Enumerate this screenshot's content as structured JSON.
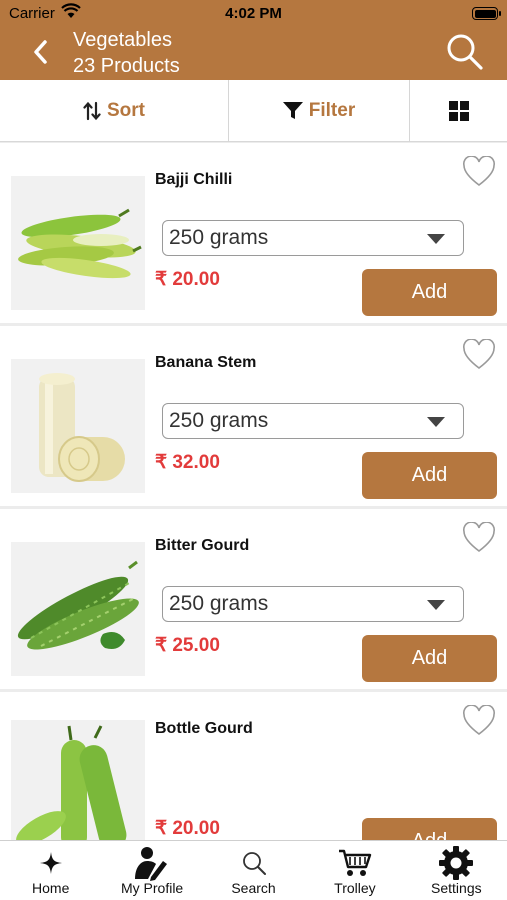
{
  "status_bar": {
    "carrier": "Carrier",
    "time": "4:02 PM"
  },
  "header": {
    "category": "Vegetables",
    "product_count": "23 Products"
  },
  "toolbar": {
    "sort_label": "Sort",
    "filter_label": "Filter"
  },
  "colors": {
    "brand": "#b5773f",
    "price": "#e23b3b"
  },
  "products": [
    {
      "name": "Bajji Chilli",
      "quantity": "250 grams",
      "price": "₹ 20.00",
      "add_label": "Add"
    },
    {
      "name": "Banana Stem",
      "quantity": "250 grams",
      "price": "₹ 32.00",
      "add_label": "Add"
    },
    {
      "name": "Bitter Gourd",
      "quantity": "250 grams",
      "price": "₹ 25.00",
      "add_label": "Add"
    },
    {
      "name": "Bottle Gourd",
      "price": "₹ 20.00",
      "add_label": "Add"
    }
  ],
  "tabbar": {
    "items": [
      {
        "label": "Home",
        "icon": "sparkle-icon"
      },
      {
        "label": "My Profile",
        "icon": "profile-edit-icon"
      },
      {
        "label": "Search",
        "icon": "search-icon"
      },
      {
        "label": "Trolley",
        "icon": "cart-icon"
      },
      {
        "label": "Settings",
        "icon": "gear-icon"
      }
    ]
  }
}
